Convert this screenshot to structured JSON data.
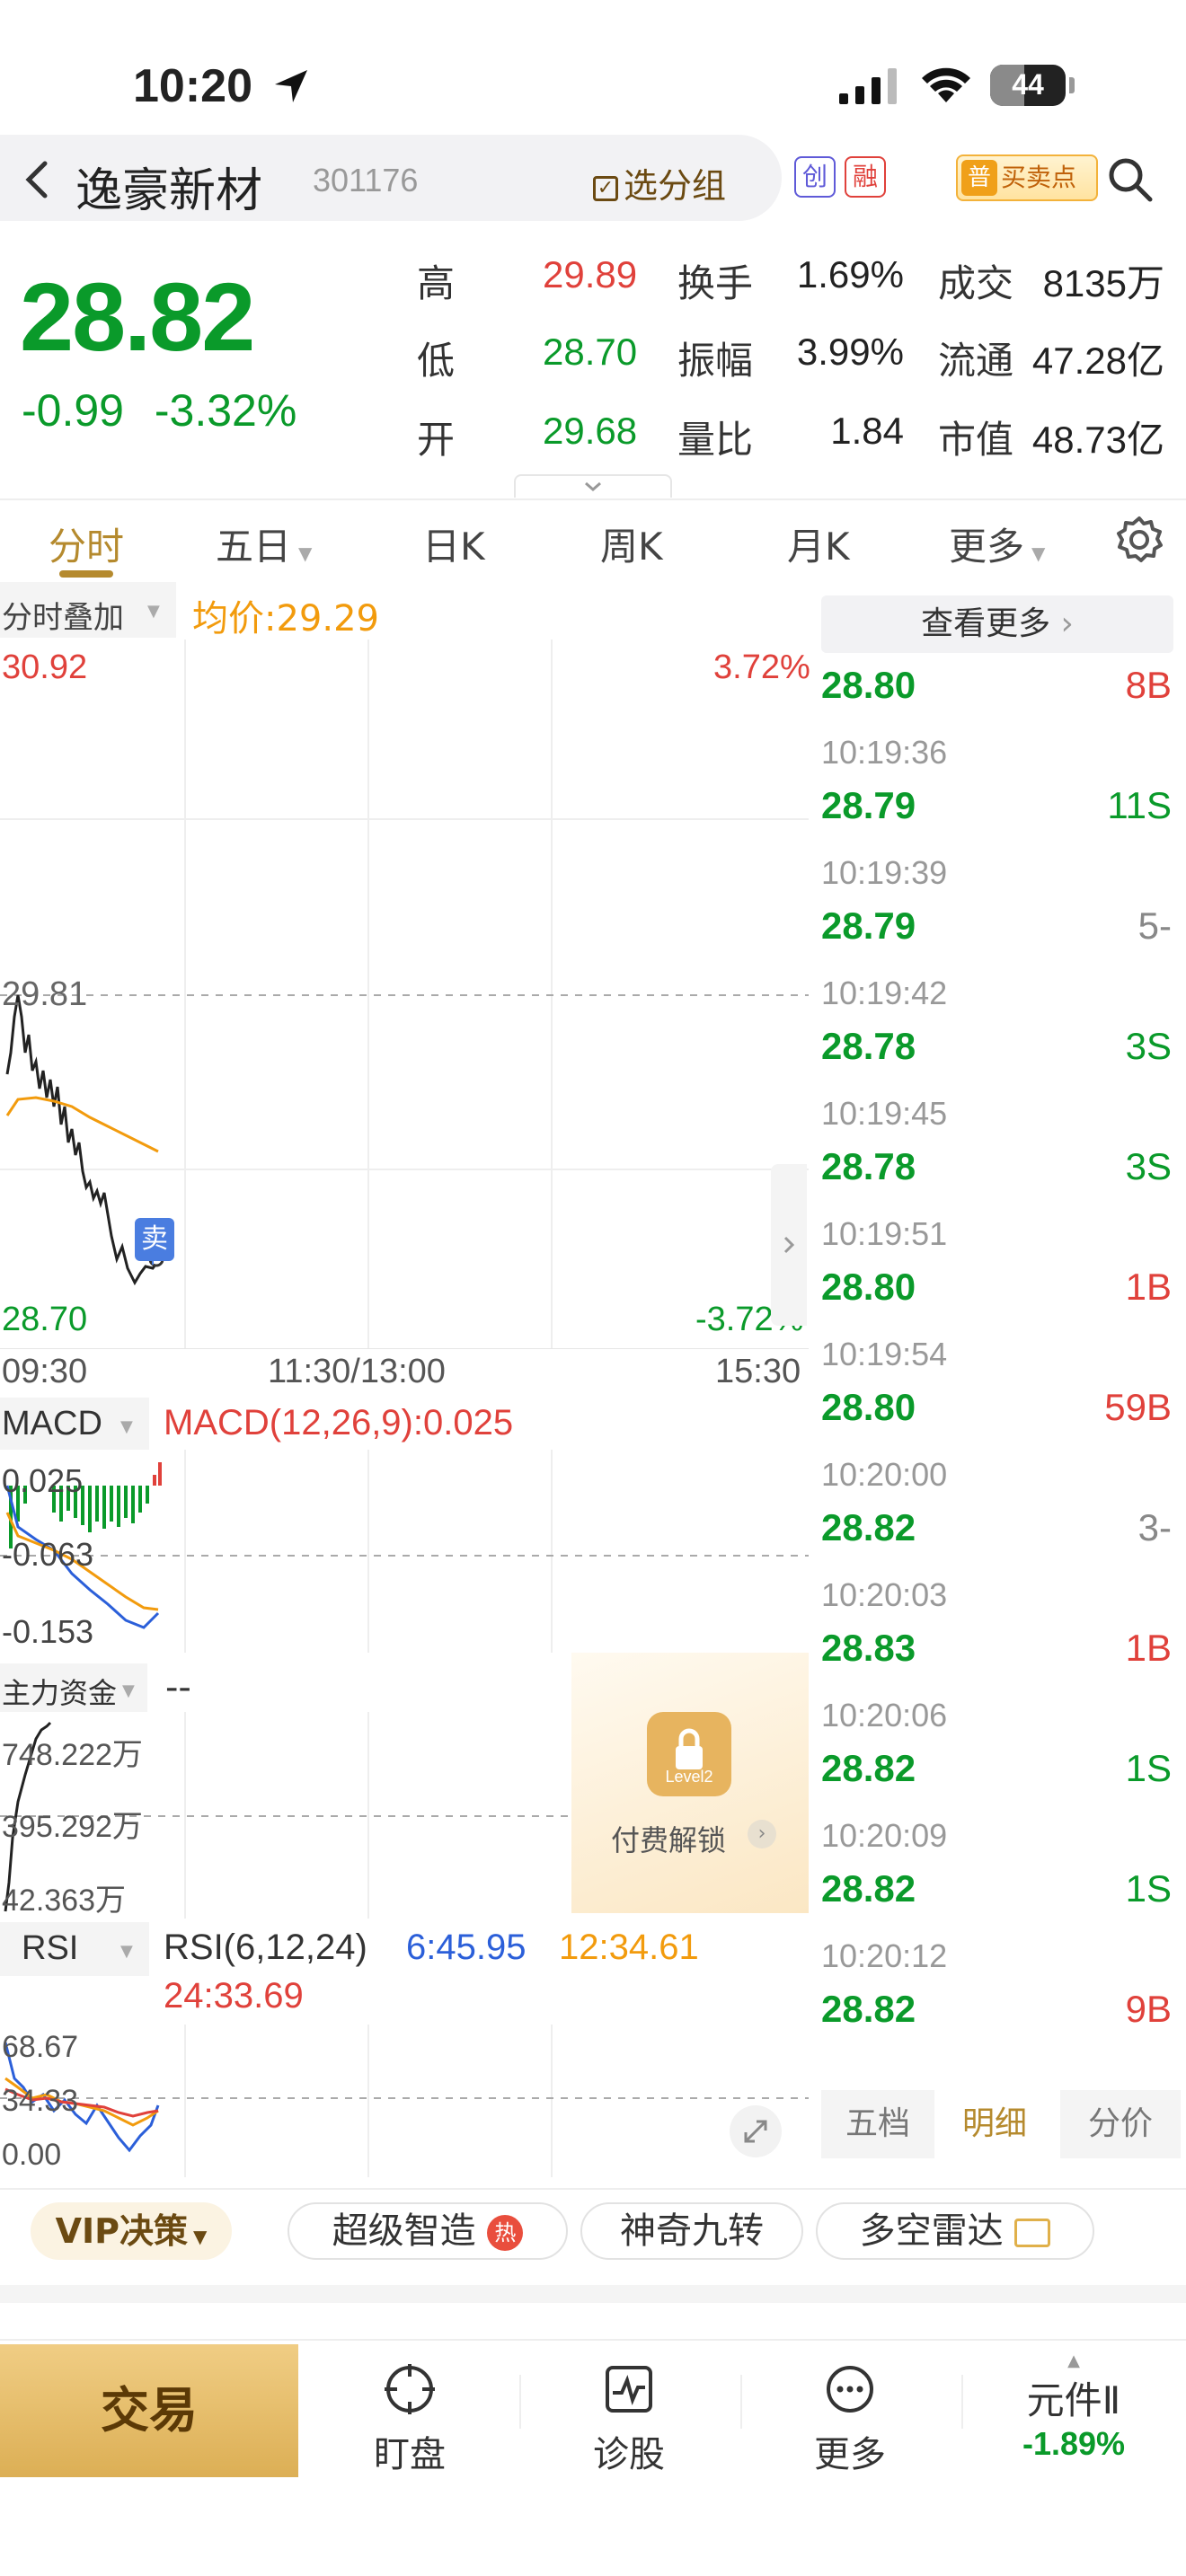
{
  "status_bar": {
    "time": "10:20",
    "battery": "44"
  },
  "header": {
    "stock_name": "逸豪新材",
    "stock_code": "301176",
    "group_btn": "选分组",
    "badge_chuang": "创",
    "badge_rong": "融",
    "badge_pu": "普",
    "buysell": "买卖点"
  },
  "quote": {
    "price": "28.82",
    "change": "-0.99",
    "change_pct": "-3.32%",
    "rows": [
      {
        "l1": "高",
        "v1": "29.89",
        "c1": "red",
        "l2": "换手",
        "v2": "1.69%",
        "l3": "成交",
        "v3": "8135万"
      },
      {
        "l1": "低",
        "v1": "28.70",
        "c1": "green",
        "l2": "振幅",
        "v2": "3.99%",
        "l3": "流通",
        "v3": "47.28亿"
      },
      {
        "l1": "开",
        "v1": "29.68",
        "c1": "green",
        "l2": "量比",
        "v2": "1.84",
        "l3": "市值",
        "v3": "48.73亿"
      }
    ]
  },
  "tabs": [
    "分时",
    "五日",
    "日K",
    "周K",
    "月K",
    "更多"
  ],
  "intraday": {
    "overlay_label": "分时叠加",
    "avg_label": "均价:29.29",
    "y_high": "30.92",
    "pct_high": "3.72%",
    "y_mid": "29.81",
    "y_low": "28.70",
    "pct_low": "-3.72%",
    "sell_marker": "卖",
    "time_start": "09:30",
    "time_mid": "11:30/13:00",
    "time_end": "15:30"
  },
  "macd": {
    "label": "MACD",
    "params": "MACD(12,26,9):0.025",
    "y1": "0.025",
    "y2": "-0.063",
    "y3": "-0.153"
  },
  "main_funds": {
    "label": "主力资金",
    "value": "--",
    "y1": "748.222万",
    "y2": "395.292万",
    "y3": "42.363万",
    "unlock_text": "付费解锁",
    "level2": "Level2"
  },
  "rsi": {
    "label": "RSI",
    "params": "RSI(6,12,24)",
    "rsi6": "6:45.95",
    "rsi12": "12:34.61",
    "rsi24": "24:33.69",
    "y1": "68.67",
    "y2": "34.33",
    "y3": "0.00"
  },
  "trades": {
    "see_more": "查看更多",
    "list": [
      {
        "time": "",
        "price": "28.80",
        "vol": "8B",
        "c": "red"
      },
      {
        "time": "10:19:36",
        "price": "28.79",
        "vol": "11S",
        "c": "green"
      },
      {
        "time": "10:19:39",
        "price": "28.79",
        "vol": "5-",
        "c": "gray"
      },
      {
        "time": "10:19:42",
        "price": "28.78",
        "vol": "3S",
        "c": "green"
      },
      {
        "time": "10:19:45",
        "price": "28.78",
        "vol": "3S",
        "c": "green"
      },
      {
        "time": "10:19:51",
        "price": "28.80",
        "vol": "1B",
        "c": "red"
      },
      {
        "time": "10:19:54",
        "price": "28.80",
        "vol": "59B",
        "c": "red"
      },
      {
        "time": "10:20:00",
        "price": "28.82",
        "vol": "3-",
        "c": "gray"
      },
      {
        "time": "10:20:03",
        "price": "28.83",
        "vol": "1B",
        "c": "red"
      },
      {
        "time": "10:20:06",
        "price": "28.82",
        "vol": "1S",
        "c": "green"
      },
      {
        "time": "10:20:09",
        "price": "28.82",
        "vol": "1S",
        "c": "green"
      },
      {
        "time": "10:20:12",
        "price": "28.82",
        "vol": "9B",
        "c": "red"
      }
    ],
    "tabs": [
      "五档",
      "明细",
      "分价"
    ]
  },
  "strategy": {
    "vip": "VIP决策",
    "items": [
      "超级智造",
      "神奇九转",
      "多空雷达"
    ],
    "hot": "热"
  },
  "bottom_nav": {
    "trade": "交易",
    "items": [
      "盯盘",
      "诊股",
      "更多"
    ],
    "component_name": "元件Ⅱ",
    "component_pct": "-1.89%"
  },
  "colors": {
    "up": "#e0413b",
    "down": "#0a9a2a",
    "accent": "#b58a2e",
    "avg_line": "#f29b0d"
  }
}
